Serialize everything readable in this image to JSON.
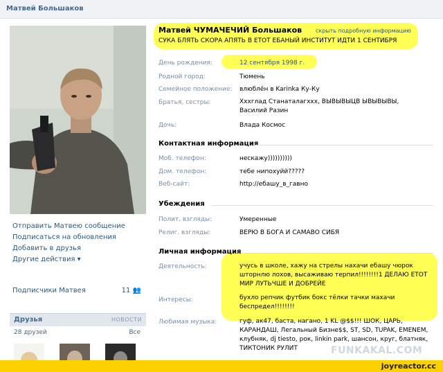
{
  "page_title": "Матвей Большаков",
  "profile": {
    "name": "Матвей ЧУМАЧЕЧИЙ Большаков",
    "hide_link": "скрыть подробную информацию",
    "status": "СУКА БЛЯТЬ СКОРА АПЯТЬ В ЕТОТ ЕБАНЫЙ ИНСТИТУТ ИДТИ 1 СЕНТИБРЯ"
  },
  "basic_info": [
    {
      "label": "День рождения:",
      "value": "12 сентября 1998 г."
    },
    {
      "label": "Родной город:",
      "value": "Тюмень"
    },
    {
      "label": "Семейное положение:",
      "value": "влюблён в Karinka Ку-Ку"
    },
    {
      "label": "Братья, сестры:",
      "value": "Ххxглад Станаталагxxx, ВЫВЫВЫЦВ ЫВЫВЫВЫ, Василий Разин"
    },
    {
      "label": "Дочь:",
      "value": "Влада Космос"
    }
  ],
  "contacts": {
    "heading": "Контактная информация",
    "rows": [
      {
        "label": "Моб. телефон:",
        "value": "нескажу))))))))))"
      },
      {
        "label": "Дом. телефон:",
        "value": "тебе нипохуйй?????"
      },
      {
        "label": "Веб-сайт:",
        "value": "http://ебашу_в_гавно"
      }
    ]
  },
  "beliefs": {
    "heading": "Убеждения",
    "rows": [
      {
        "label": "Полит. взгляды:",
        "value": "Умеренные"
      },
      {
        "label": "Религ. взгляды:",
        "value": "ВЕРЮ В БОГА И САМАВО СИБЯ"
      }
    ]
  },
  "personal": {
    "heading": "Личная информация",
    "rows": [
      {
        "label": "Деятельность:",
        "value": "учусь в школе, хажу на стрелы нахачи ебашу чюрок шторнлю лохов, высаживаю терпил!!!!!!!!1 ДЕЛАЮ ЕТОТ МИР ЛУТЬЧШЕ И ДОБРЕЙЕ"
      },
      {
        "label": "Интересы:",
        "value": "бухло репчик футбик бокс тёлки тачки махачи беспредел!!!!!!!!"
      },
      {
        "label": "Любимая музыка:",
        "value": "гуф, ак47, баста, нагано, 1 KL @$$!!! ШОК, ЦАРЬ, КАРАНДАШ, Легальный Бизне$$, ST, SD, TUPAK, EMENEM, клубняк, dj tiesto, рок, linkin park, шансон, круг, блатняк, ТИКТОНИК РУЛИТ"
      }
    ]
  },
  "actions": [
    "Отправить Матвею сообщение",
    "Подписаться на обновления",
    "Добавить в друзья",
    "Другие действия ▾"
  ],
  "subscribers": {
    "label": "Подписчики Матвея",
    "count": "11 👥"
  },
  "friends": {
    "title": "Друзья",
    "news": "НОВОСТИ",
    "count": "28 друзей",
    "all": "Все"
  },
  "watermark": "FUNKAKAL.COM",
  "footer_brand": "joyreactor.cc",
  "colors": {
    "link": "#2b587a",
    "highlight": "#ffff2a",
    "footer": "#fdd000"
  }
}
